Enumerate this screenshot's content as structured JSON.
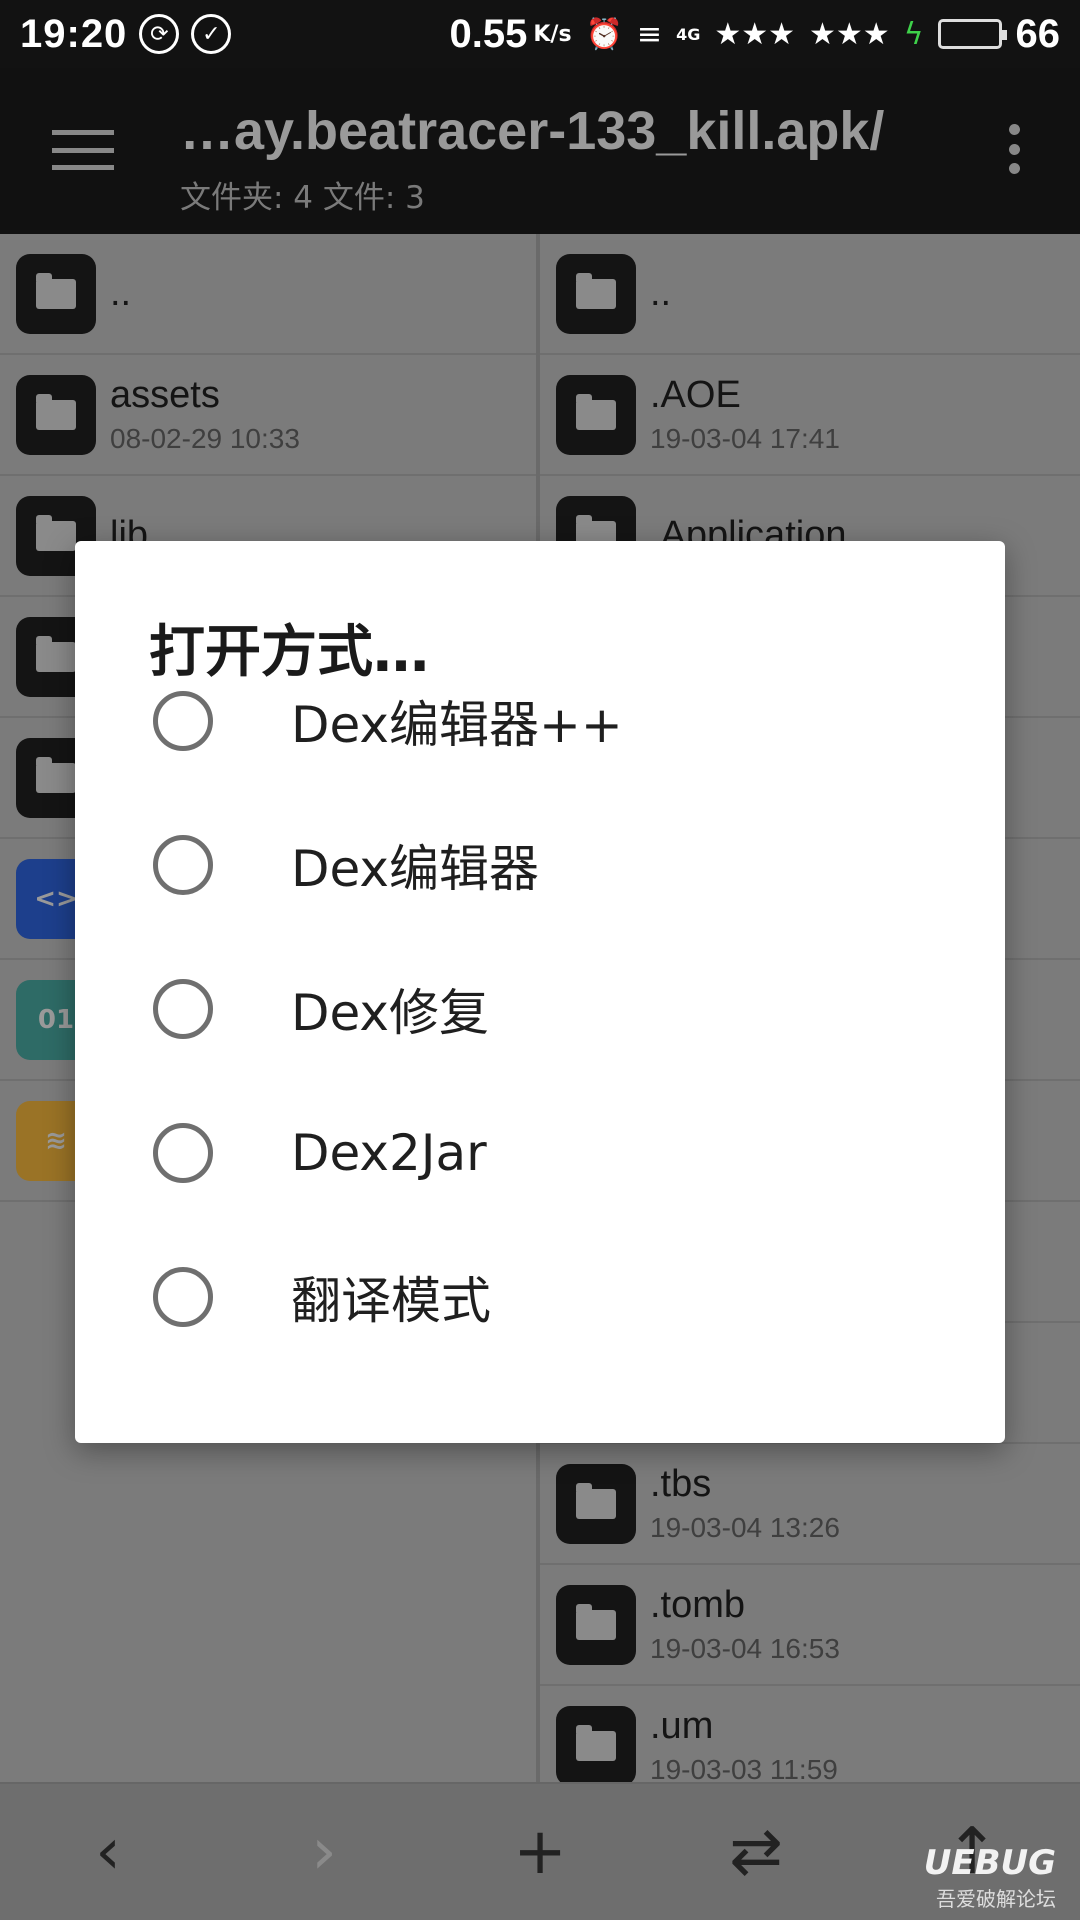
{
  "status_bar": {
    "time": "19:20",
    "speed": "0.55",
    "speed_unit": "K/s",
    "network": "4G",
    "battery_level": 66,
    "battery_text": "66",
    "battery_color": "#3ed14a"
  },
  "toolbar": {
    "title": "…ay.beatracer-133_kill.apk/",
    "subtitle": "文件夹: 4  文件: 3"
  },
  "left_pane": {
    "items": [
      {
        "name": "..",
        "date": "",
        "icon": "folder-icon"
      },
      {
        "name": "assets",
        "date": "08-02-29 10:33",
        "icon": "folder-icon"
      },
      {
        "name": "lib",
        "date": "",
        "icon": "folder-icon"
      },
      {
        "name": "",
        "date": "",
        "icon": "folder-icon"
      },
      {
        "name": "",
        "date": "",
        "icon": "folder-icon"
      },
      {
        "name": "",
        "date": "",
        "icon": "code-file-icon"
      },
      {
        "name": "",
        "date": "",
        "icon": "binary-file-icon"
      },
      {
        "name": "",
        "date": "",
        "icon": "layers-file-icon"
      }
    ]
  },
  "right_pane": {
    "items": [
      {
        "name": "..",
        "date": ""
      },
      {
        "name": ".AOE",
        "date": "19-03-04 17:41"
      },
      {
        "name": ".Application",
        "date": ""
      },
      {
        "name": "",
        "date": ""
      },
      {
        "name": "",
        "date": ""
      },
      {
        "name": "",
        "date": ""
      },
      {
        "name": "",
        "date": ""
      },
      {
        "name": "",
        "date": ""
      },
      {
        "name": "",
        "date": ""
      },
      {
        "name": "",
        "date": ""
      },
      {
        "name": ".tbs",
        "date": "19-03-04 13:26"
      },
      {
        "name": ".tomb",
        "date": "19-03-04 16:53"
      },
      {
        "name": ".um",
        "date": "19-03-03 11:59"
      }
    ]
  },
  "dialog": {
    "title": "打开方式…",
    "options": [
      "Dex编辑器++",
      "Dex编辑器",
      "Dex修复",
      "Dex2Jar",
      "翻译模式"
    ]
  },
  "bottom_bar": {
    "back": "‹",
    "forward": "›",
    "add": "+",
    "swap": "⇄",
    "up": "↑"
  },
  "watermark": {
    "logo": "UEBUG",
    "text": "吾爱破解论坛"
  }
}
